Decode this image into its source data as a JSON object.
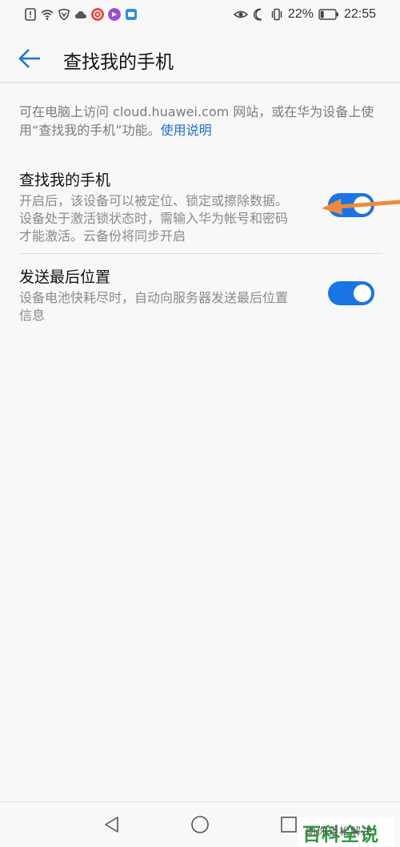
{
  "status_bar": {
    "battery_percent": "22%",
    "time": "22:55",
    "left_icons": [
      "alert-icon",
      "wifi-icon",
      "vpn-shield-icon",
      "cloud-icon",
      "app-red-icon",
      "app-purple-icon",
      "app-blue-icon"
    ],
    "right_icons": [
      "eye-comfort-icon",
      "moon-icon",
      "vibrate-icon",
      "battery-icon"
    ]
  },
  "app_bar": {
    "title": "查找我的手机"
  },
  "intro": {
    "text": "可在电脑上访问 cloud.huawei.com 网站，或在华为设备上使用“查找我的手机”功能。",
    "link": "使用说明"
  },
  "settings": [
    {
      "title": "查找我的手机",
      "description": "开启后，该设备可以被定位、锁定或擦除数据。设备处于激活锁状态时，需输入华为帐号和密码才能激活。云备份将同步开启",
      "enabled": true
    },
    {
      "title": "发送最后位置",
      "description": "设备电池快耗尽时，自动向服务器发送最后位置信息",
      "enabled": true
    }
  ],
  "nav_bar": {
    "buttons": [
      "back-triangle-icon",
      "home-circle-icon",
      "recents-square-icon"
    ]
  },
  "watermark": {
    "title": "百科全说",
    "subtitle": "助你轻松解决"
  },
  "colors": {
    "accent": "#1875e6",
    "link": "#1a6fd8",
    "annotation_arrow": "#ef8a3a",
    "watermark": "#2e9c3b"
  }
}
